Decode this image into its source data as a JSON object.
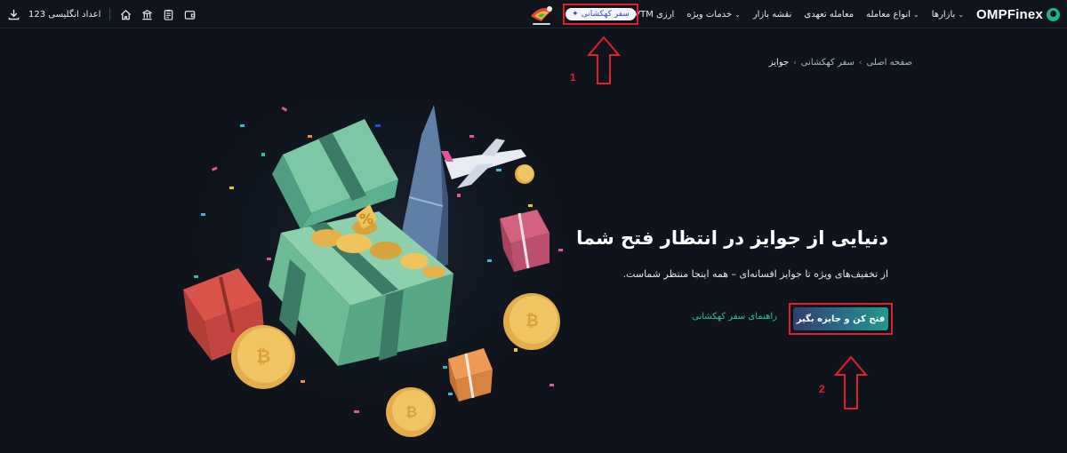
{
  "header": {
    "brand": "OMPFinex",
    "nav": [
      {
        "label": "بازارها",
        "has_menu": true
      },
      {
        "label": "انواع معامله",
        "has_menu": true
      },
      {
        "label": "معامله تعهدی",
        "has_menu": false
      },
      {
        "label": "نقشه بازار",
        "has_menu": false
      },
      {
        "label": "خدمات ویژه",
        "has_menu": true
      },
      {
        "label": "دستگاه VTM ارزی",
        "has_menu": false
      }
    ],
    "galaxy_chip": "سفر کهکشانی",
    "english_digits_label": "اعداد انگلیسی 123",
    "icons": [
      "download-icon",
      "home-icon",
      "bank-icon",
      "orders-icon",
      "wallet-icon"
    ]
  },
  "annotations": {
    "marker_1": "1",
    "marker_2": "2"
  },
  "breadcrumb": {
    "home": "صفحه اصلی",
    "parent": "سفر کهکشانی",
    "current": "جوایز"
  },
  "hero": {
    "title": "دنیایی از جوایز در انتظار فتح شما",
    "subtitle": "از تخفیف‌های ویژه تا جوایز افسانه‌ای – همه اینجا منتظر شماست.",
    "cta": "فتح کن و جایزه بگیر",
    "guide": "راهنمای سفر کهکشانی"
  },
  "colors": {
    "background": "#0f141c",
    "accent_green": "#2fc08f",
    "annotation_red": "#e0202a",
    "chip_text": "#2d4bd8"
  }
}
